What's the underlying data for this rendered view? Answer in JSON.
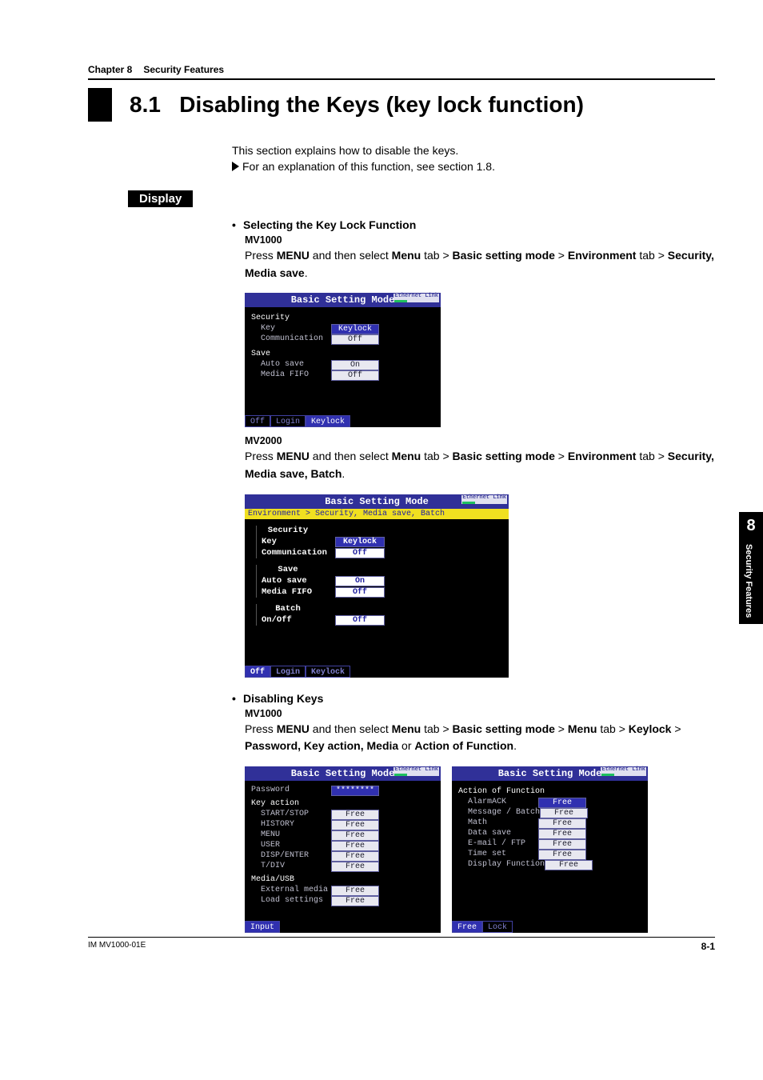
{
  "header": {
    "chapter_label": "Chapter 8",
    "chapter_title": "Security Features",
    "section_number": "8.1",
    "section_title": "Disabling the Keys (key lock function)"
  },
  "intro": {
    "line1": "This section explains how to disable the keys.",
    "ref": "For an explanation of this function, see section 1.8."
  },
  "display_label": "Display",
  "sub1": {
    "title": "Selecting the Key Lock Function",
    "model1": "MV1000",
    "instr1_a": "Press ",
    "instr1_b": "MENU",
    "instr1_c": " and then select ",
    "instr1_d": "Menu",
    "instr1_e": " tab > ",
    "instr1_f": "Basic setting mode",
    "instr1_g": " > ",
    "instr1_h": "Environment",
    "instr1_i": " tab > ",
    "instr1_j": "Security, Media save",
    "instr1_k": ".",
    "model2": "MV2000",
    "instr2_j": "Security, Media save, Batch"
  },
  "sub2": {
    "title": "Disabling Keys",
    "model1": "MV1000",
    "instr_a": "Press ",
    "instr_b": "MENU",
    "instr_c": " and then select ",
    "instr_d": "Menu",
    "instr_e": " tab > ",
    "instr_f": "Basic setting mode",
    "instr_g": " > ",
    "instr_h": "Menu",
    "instr_i": " tab > ",
    "instr_j": "Keylock",
    "instr_k": " > ",
    "instr_l": "Password, Key action, Media",
    "instr_m": " or ",
    "instr_n": "Action of Function",
    "instr_o": "."
  },
  "screenshot1": {
    "title": "Basic Setting Mode",
    "eth": "Ethernet\nLink",
    "grp_security": "Security",
    "k_key": "  Key",
    "v_key": "Keylock",
    "k_comm": "  Communication",
    "v_comm": "Off",
    "grp_save": "Save",
    "k_auto": "  Auto save",
    "v_auto": "On",
    "k_fifo": "  Media FIFO",
    "v_fifo": "Off",
    "tab_off": "Off",
    "tab_login": "Login",
    "tab_keylock": "Keylock"
  },
  "screenshot2": {
    "title": "Basic Setting Mode",
    "eth": "Ethernet\nLink",
    "breadcrumb": "Environment > Security, Media save, Batch",
    "grp_security": "Security",
    "k_key": "Key",
    "v_key": "Keylock",
    "k_comm": "Communication",
    "v_comm": "Off",
    "grp_save": "Save",
    "k_auto": "Auto save",
    "v_auto": "On",
    "k_fifo": "Media FIFO",
    "v_fifo": "Off",
    "grp_batch": "Batch",
    "k_onoff": "On/Off",
    "v_onoff": "Off",
    "tab_off": "Off",
    "tab_login": "Login",
    "tab_keylock": "Keylock"
  },
  "screenshot3": {
    "title": "Basic Setting Mode",
    "k_password": "Password",
    "v_password": "********",
    "grp_key": "Key action",
    "k_start": "  START/STOP",
    "v_start": "Free",
    "k_hist": "  HISTORY",
    "v_hist": "Free",
    "k_menu": "  MENU",
    "v_menu": "Free",
    "k_user": "  USER",
    "v_user": "Free",
    "k_disp": "  DISP/ENTER",
    "v_disp": "Free",
    "k_tdiv": "  T/DIV",
    "v_tdiv": "Free",
    "grp_media": "Media/USB",
    "k_ext": "  External media",
    "v_ext": "Free",
    "k_load": "  Load settings",
    "v_load": "Free",
    "tab_input": "Input"
  },
  "screenshot4": {
    "title": "Basic Setting Mode",
    "grp": "Action of Function",
    "k_alarm": "  AlarmACK",
    "v_alarm": "Free",
    "k_msg": "  Message / Batch",
    "v_msg": "Free",
    "k_math": "  Math",
    "v_math": "Free",
    "k_data": "  Data save",
    "v_data": "Free",
    "k_email": "  E-mail / FTP",
    "v_email": "Free",
    "k_time": "  Time set",
    "v_time": "Free",
    "k_dispf": "  Display Function",
    "v_dispf": "Free",
    "tab_free": "Free",
    "tab_lock": "Lock"
  },
  "side": {
    "num": "8",
    "label": "Security Features"
  },
  "footer": {
    "doc": "IM MV1000-01E",
    "page": "8-1"
  }
}
